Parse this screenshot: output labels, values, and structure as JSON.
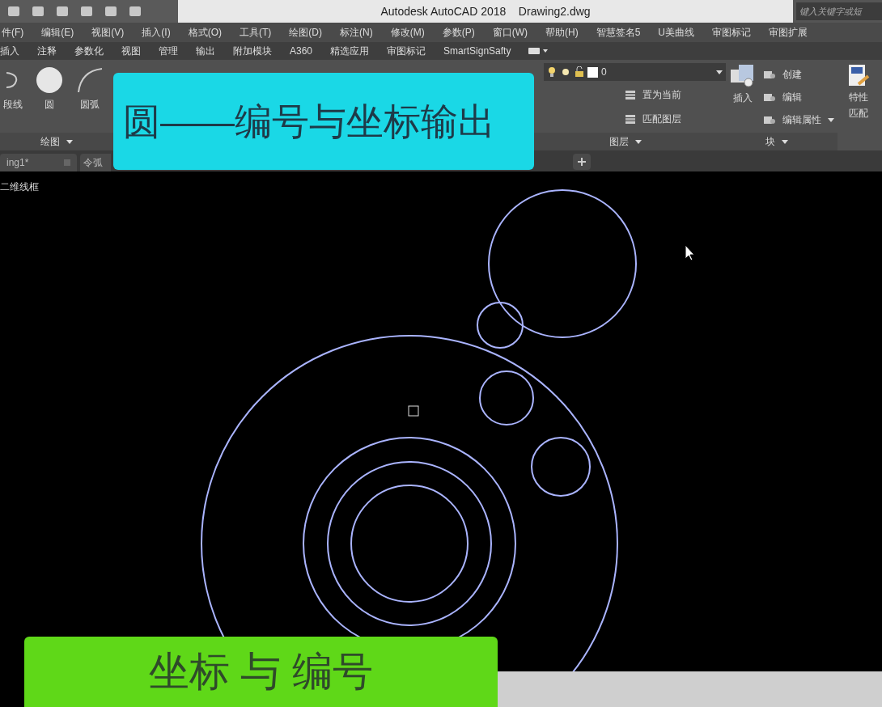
{
  "window": {
    "title": "Autodesk AutoCAD 2018    Drawing2.dwg"
  },
  "search": {
    "placeholder": "键入关键字或短"
  },
  "menu_bar": [
    "件(F)",
    "编辑(E)",
    "视图(V)",
    "插入(I)",
    "格式(O)",
    "工具(T)",
    "绘图(D)",
    "标注(N)",
    "修改(M)",
    "参数(P)",
    "窗口(W)",
    "帮助(H)",
    "智慧签名5",
    "U美曲线",
    "审图标记",
    "审图扩展"
  ],
  "ribbon_tabs": [
    "插入",
    "注释",
    "参数化",
    "视图",
    "管理",
    "输出",
    "附加模块",
    "A360",
    "精选应用",
    "审图标记",
    "SmartSignSafty"
  ],
  "draw_panel": {
    "tools": [
      "段线",
      "圆",
      "圆弧"
    ],
    "title": "绘图"
  },
  "layer_panel": {
    "layer": "0",
    "actions": [
      "置为当前",
      "匹配图层"
    ],
    "title": "图层"
  },
  "block_panel": {
    "insert": "插入",
    "actions": [
      "创建",
      "编辑",
      "编辑属性"
    ],
    "title": "块"
  },
  "match_properties": {
    "lines": [
      "特性",
      "匹配"
    ]
  },
  "file_tabs": [
    "ing1*",
    "令弧"
  ],
  "viewport": {
    "label": "二维线框"
  },
  "captions": [
    {
      "text": "圆——编号与坐标输出",
      "color": "#1ad8e6"
    },
    {
      "text": "坐标 与 编号",
      "color": "#5fd818"
    }
  ]
}
